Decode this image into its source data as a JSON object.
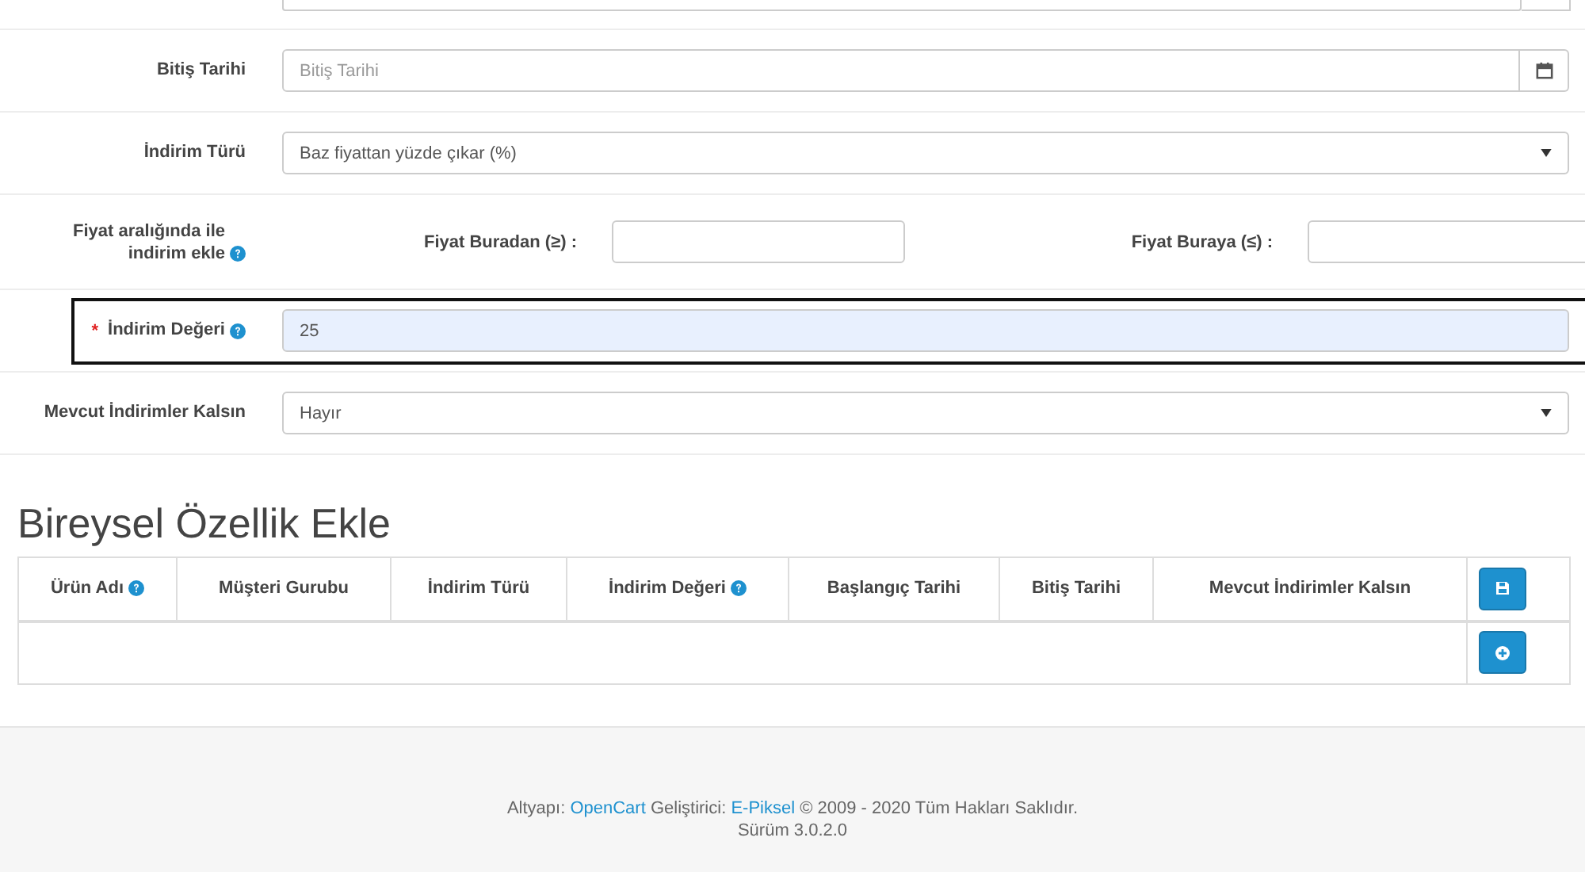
{
  "form": {
    "rows": [
      {
        "kind": "partial"
      },
      {
        "kind": "date",
        "label": "Bitiş Tarihi",
        "placeholder": "Bitiş Tarihi"
      },
      {
        "kind": "select",
        "label": "İndirim Türü",
        "value": "Baz fiyattan yüzde çıkar (%)"
      },
      {
        "kind": "range",
        "label": "Fiyat aralığında ile indirim ekle",
        "help": true,
        "fields": [
          {
            "label": "Fiyat Buradan (≥) :"
          },
          {
            "label": "Fiyat Buraya (≤) :"
          }
        ]
      },
      {
        "kind": "input",
        "label": "İndirim Değeri",
        "required": "*",
        "help": true,
        "value": "25",
        "focused": true
      },
      {
        "kind": "select",
        "label": "Mevcut İndirimler Kalsın",
        "value": "Hayır"
      }
    ]
  },
  "section": {
    "title": "Bireysel Özellik Ekle",
    "table": {
      "columns": [
        {
          "label": "Ürün Adı",
          "help": true
        },
        {
          "label": "Müşteri Gurubu"
        },
        {
          "label": "İndirim Türü"
        },
        {
          "label": "İndirim Değeri",
          "help": true
        },
        {
          "label": "Başlangıç Tarihi"
        },
        {
          "label": "Bitiş Tarihi"
        },
        {
          "label": "Mevcut İndirimler Kalsın"
        },
        {
          "kind": "save-button"
        }
      ],
      "row_buttons": [
        {
          "kind": "add-button"
        }
      ]
    }
  },
  "footer": {
    "lines": [
      [
        {
          "text": "Altyapı: "
        },
        {
          "text": "OpenCart",
          "link": true
        },
        {
          "text": " Geliştirici: "
        },
        {
          "text": "E-Piksel",
          "link": true
        },
        {
          "text": " © 2009 - 2020 Tüm Hakları Saklıdır."
        }
      ],
      [
        {
          "text": "Sürüm 3.0.2.0"
        }
      ]
    ]
  }
}
